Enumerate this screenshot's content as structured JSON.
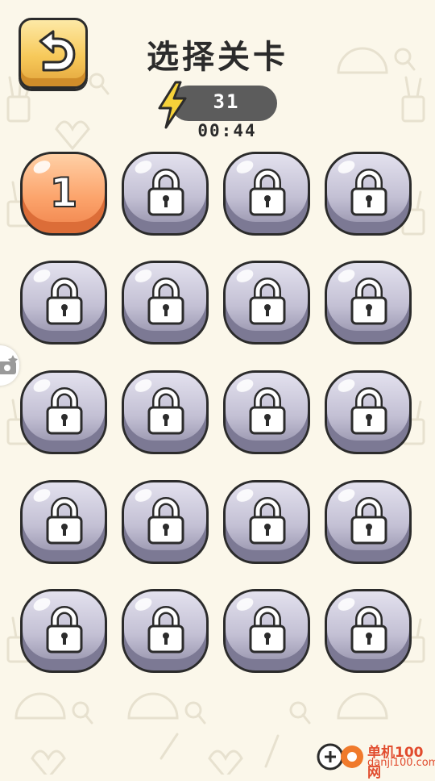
{
  "header": {
    "title": "选择关卡",
    "energy": "31",
    "timer": "00:44"
  },
  "levels": [
    {
      "label": "1",
      "locked": false
    },
    {
      "label": "",
      "locked": true
    },
    {
      "label": "",
      "locked": true
    },
    {
      "label": "",
      "locked": true
    },
    {
      "label": "",
      "locked": true
    },
    {
      "label": "",
      "locked": true
    },
    {
      "label": "",
      "locked": true
    },
    {
      "label": "",
      "locked": true
    },
    {
      "label": "",
      "locked": true
    },
    {
      "label": "",
      "locked": true
    },
    {
      "label": "",
      "locked": true
    },
    {
      "label": "",
      "locked": true
    },
    {
      "label": "",
      "locked": true
    },
    {
      "label": "",
      "locked": true
    },
    {
      "label": "",
      "locked": true
    },
    {
      "label": "",
      "locked": true
    },
    {
      "label": "",
      "locked": true
    },
    {
      "label": "",
      "locked": true
    },
    {
      "label": "",
      "locked": true
    },
    {
      "label": "",
      "locked": true
    }
  ],
  "watermark": {
    "name": "单机100网",
    "url": "danji100.com"
  },
  "colors": {
    "background": "#fbf7ea",
    "unlocked": "#fca46c",
    "locked": "#c3c0d4",
    "back_button": "#f7c95a",
    "energy_bar": "#5c5c5c",
    "bolt": "#f6d23a"
  },
  "icons": {
    "back": "back-arrow-icon",
    "energy": "lightning-bolt-icon",
    "lock": "padlock-icon",
    "side": "camera-icon"
  }
}
